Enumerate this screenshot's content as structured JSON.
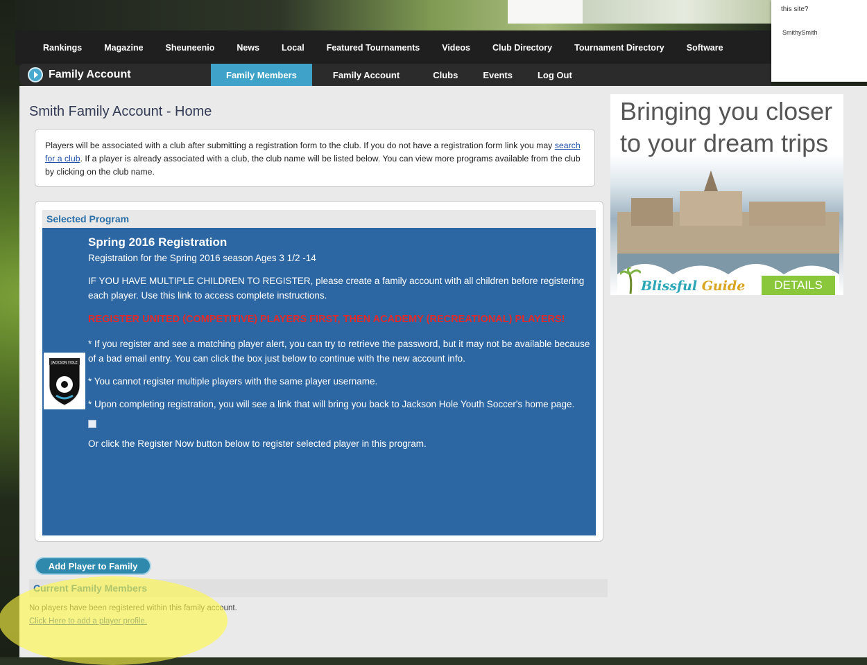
{
  "popup": {
    "question": "this site?",
    "username": "SmithySmith"
  },
  "main_nav": {
    "items": [
      "Rankings",
      "Magazine",
      "Sheuneenio",
      "News",
      "Local",
      "Featured Tournaments",
      "Videos",
      "Club Directory",
      "Tournament Directory",
      "Software"
    ]
  },
  "sub_nav": {
    "brand": "Family Account",
    "tabs": [
      "Family Members",
      "Family Account",
      "Clubs",
      "Events",
      "Log Out"
    ],
    "active_tab": "Family Members"
  },
  "page": {
    "title": "Smith Family Account - Home",
    "info_before_link": "Players will be associated with a club after submitting a registration form to the club. If you do not have a registration form link you may ",
    "info_link": "search for a club",
    "info_after_link": ". If a player is already associated with a club, the club name will be listed below. You can view more programs available from the club by clicking on the club name."
  },
  "program": {
    "section_label": "Selected Program",
    "title": "Spring 2016 Registration",
    "subtitle": "Registration for the Spring 2016 season Ages 3 1/2 -14",
    "paragraph1": "IF YOU HAVE MULTIPLE CHILDREN TO REGISTER, please create a family account with all children before registering each player. Use this link to access complete instructions.",
    "warning": "REGISTER UNITED (COMPETITIVE) PLAYERS FIRST, THEN ACADEMY (RECREATIONAL) PLAYERS!",
    "note1": "* If you register and see a matching player alert, you can try to retrieve the password, but it may not be available because of a bad email entry. You can click the box just below to continue with the new account info.",
    "note2": "* You cannot register multiple players with the same player username.",
    "note3": "* Upon completing registration, you will see a link that will bring you back to Jackson Hole Youth Soccer's home page.",
    "closing": "Or click the Register Now button below to register selected player in this program.",
    "logo_text": "JACKSON HOLE"
  },
  "family": {
    "add_button": "Add Player to Family",
    "section_label": "Current Family Members",
    "empty_text": "No players have been registered within this family account.",
    "add_link": "Click Here to add a player profile."
  },
  "ad": {
    "headline": "Bringing you closer to your dream trips",
    "brand_part1": "Blissful",
    "brand_part2": " Guide",
    "cta": "DETAILS"
  },
  "colors": {
    "accent": "#3fa2c8",
    "program_bg": "#2d67a3",
    "warning": "#e12b2b",
    "highlight": "#fff846"
  }
}
